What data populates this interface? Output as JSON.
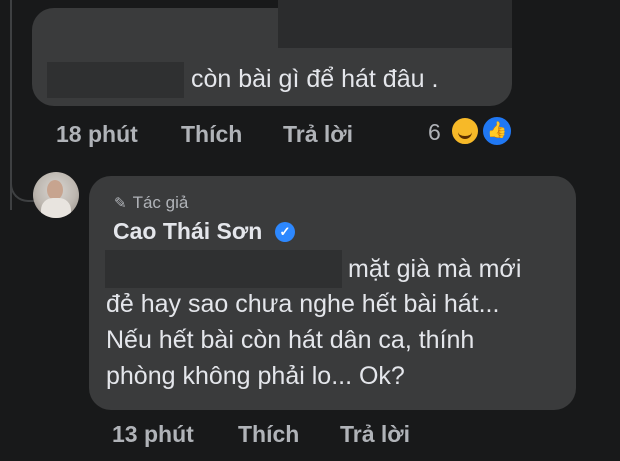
{
  "comment1": {
    "text": "còn bài gì để hát đâu .",
    "time": "18 phút",
    "like_label": "Thích",
    "reply_label": "Trả lời",
    "reaction_count": "6",
    "reactions": [
      "haha-icon",
      "like-icon"
    ]
  },
  "reply": {
    "author_badge": "Tác giả",
    "author_name": "Cao Thái Sơn",
    "verified": true,
    "lines": [
      "mặt già mà mới",
      "đẻ hay sao chưa nghe hết bài hát...",
      "Nếu hết bài còn hát dân ca, thính",
      "phòng không phải lo... Ok?"
    ],
    "time": "13 phút",
    "like_label": "Thích",
    "reply_label": "Trả lời"
  },
  "colors": {
    "background": "#18191a",
    "bubble": "#3a3b3c",
    "text": "#e4e6eb",
    "secondary_text": "#b0b3b8",
    "verified_blue": "#2d88ff"
  }
}
